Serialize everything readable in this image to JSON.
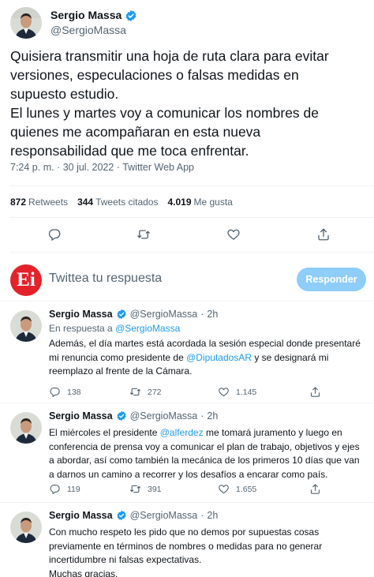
{
  "main_tweet": {
    "author_name": "Sergio Massa",
    "author_handle": "@SergioMassa",
    "text_lines": [
      "Quisiera transmitir una hoja de ruta clara para evitar",
      "versiones, especulaciones o falsas medidas en",
      "supuesto estudio.",
      "El lunes y martes voy a comunicar los nombres de",
      "quienes me acompañaran en esta nueva",
      "responsabilidad que me toca enfrentar."
    ],
    "meta": "7:24 p. m. · 30 jul. 2022 · Twitter Web App",
    "stats": {
      "retweets_count": "872",
      "retweets_label": "Retweets",
      "quotes_count": "344",
      "quotes_label": "Tweets citados",
      "likes_count": "4.019",
      "likes_label": "Me gusta"
    }
  },
  "composer": {
    "logo_text": "Ei",
    "placeholder": "Twittea tu respuesta",
    "button_label": "Responder"
  },
  "replies": [
    {
      "author_name": "Sergio Massa",
      "author_handle": "@SergioMassa",
      "dot": "·",
      "time": "2h",
      "reply_to_prefix": "En respuesta a ",
      "reply_to_handle": "@SergioMassa",
      "segments": [
        {
          "text": "Además, el día martes está acordada la sesión especial donde presentaré mi renuncia como presidente de ",
          "link": false
        },
        {
          "text": "@DiputadosAR",
          "link": true
        },
        {
          "text": " y se designará mi reemplazo al frente de la Cámara.",
          "link": false
        }
      ],
      "replies_count": "138",
      "retweets_count": "272",
      "likes_count": "1.145"
    },
    {
      "author_name": "Sergio Massa",
      "author_handle": "@SergioMassa",
      "dot": "·",
      "time": "2h",
      "segments": [
        {
          "text": "El miércoles el presidente ",
          "link": false
        },
        {
          "text": "@alferdez",
          "link": true
        },
        {
          "text": " me tomará juramento y luego en conferencia de prensa voy a comunicar el plan de trabajo, objetivos y ejes a abordar, así como también la mecánica de los primeros 10 días que van a darnos un camino a recorrer y los desafíos a encarar como país.",
          "link": false
        }
      ],
      "replies_count": "119",
      "retweets_count": "391",
      "likes_count": "1.655"
    },
    {
      "author_name": "Sergio Massa",
      "author_handle": "@SergioMassa",
      "dot": "·",
      "time": "2h",
      "segments": [
        {
          "text": "Con mucho respeto les pido que no demos por supuestas cosas previamente en términos de nombres o medidas para no generar incertidumbre ni falsas expectativas.",
          "link": false
        }
      ],
      "closing": "Muchas gracias."
    }
  ],
  "colors": {
    "accent": "#1d9bf0",
    "reply_button": "#8ecdf8",
    "logo_red": "#e3222a",
    "text": "#0f1419",
    "muted": "#536471"
  }
}
